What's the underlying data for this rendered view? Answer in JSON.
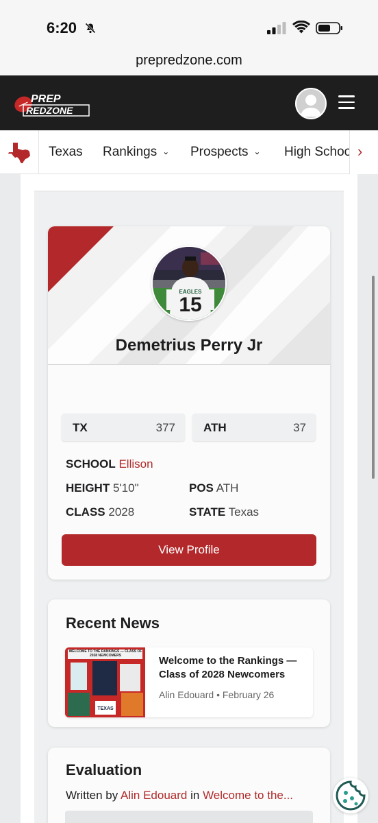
{
  "status_bar": {
    "time": "6:20"
  },
  "browser": {
    "url": "prepredzone.com"
  },
  "header": {
    "logo_top": "PREP",
    "logo_bottom": "REDZONE"
  },
  "nav": {
    "items": [
      {
        "label": "Texas",
        "has_dropdown": false
      },
      {
        "label": "Rankings",
        "has_dropdown": true
      },
      {
        "label": "Prospects",
        "has_dropdown": true
      },
      {
        "label": "High Schoo",
        "has_dropdown": false
      }
    ],
    "more_arrow": "›"
  },
  "player": {
    "name": "Demetrius Perry Jr",
    "jersey_number": "15",
    "jersey_text": "EAGLES",
    "stats": [
      {
        "key": "TX",
        "value": "377"
      },
      {
        "key": "ATH",
        "value": "37"
      }
    ],
    "school_label": "SCHOOL",
    "school": "Ellison",
    "height_label": "HEIGHT",
    "height": "5'10\"",
    "pos_label": "POS",
    "pos": "ATH",
    "class_label": "CLASS",
    "class": "2028",
    "state_label": "STATE",
    "state": "Texas",
    "view_profile": "View Profile"
  },
  "news": {
    "title": "Recent News",
    "items": [
      {
        "title": "Welcome to the Rankings — Class of 2028 Newcomers",
        "author": "Alin Edouard",
        "separator": "•",
        "date": "February 26",
        "thumb_text": "WELCOME TO THE RANKINGS — CLASS OF 2028 NEWCOMERS",
        "thumb_badge": "TEXAS"
      }
    ]
  },
  "evaluation": {
    "title": "Evaluation",
    "written_by": "Written by",
    "author": "Alin Edouard",
    "in_word": "in",
    "article": "Welcome to the..."
  },
  "colors": {
    "brand_red": "#b3292b",
    "header_bg": "#1e1e1e"
  }
}
